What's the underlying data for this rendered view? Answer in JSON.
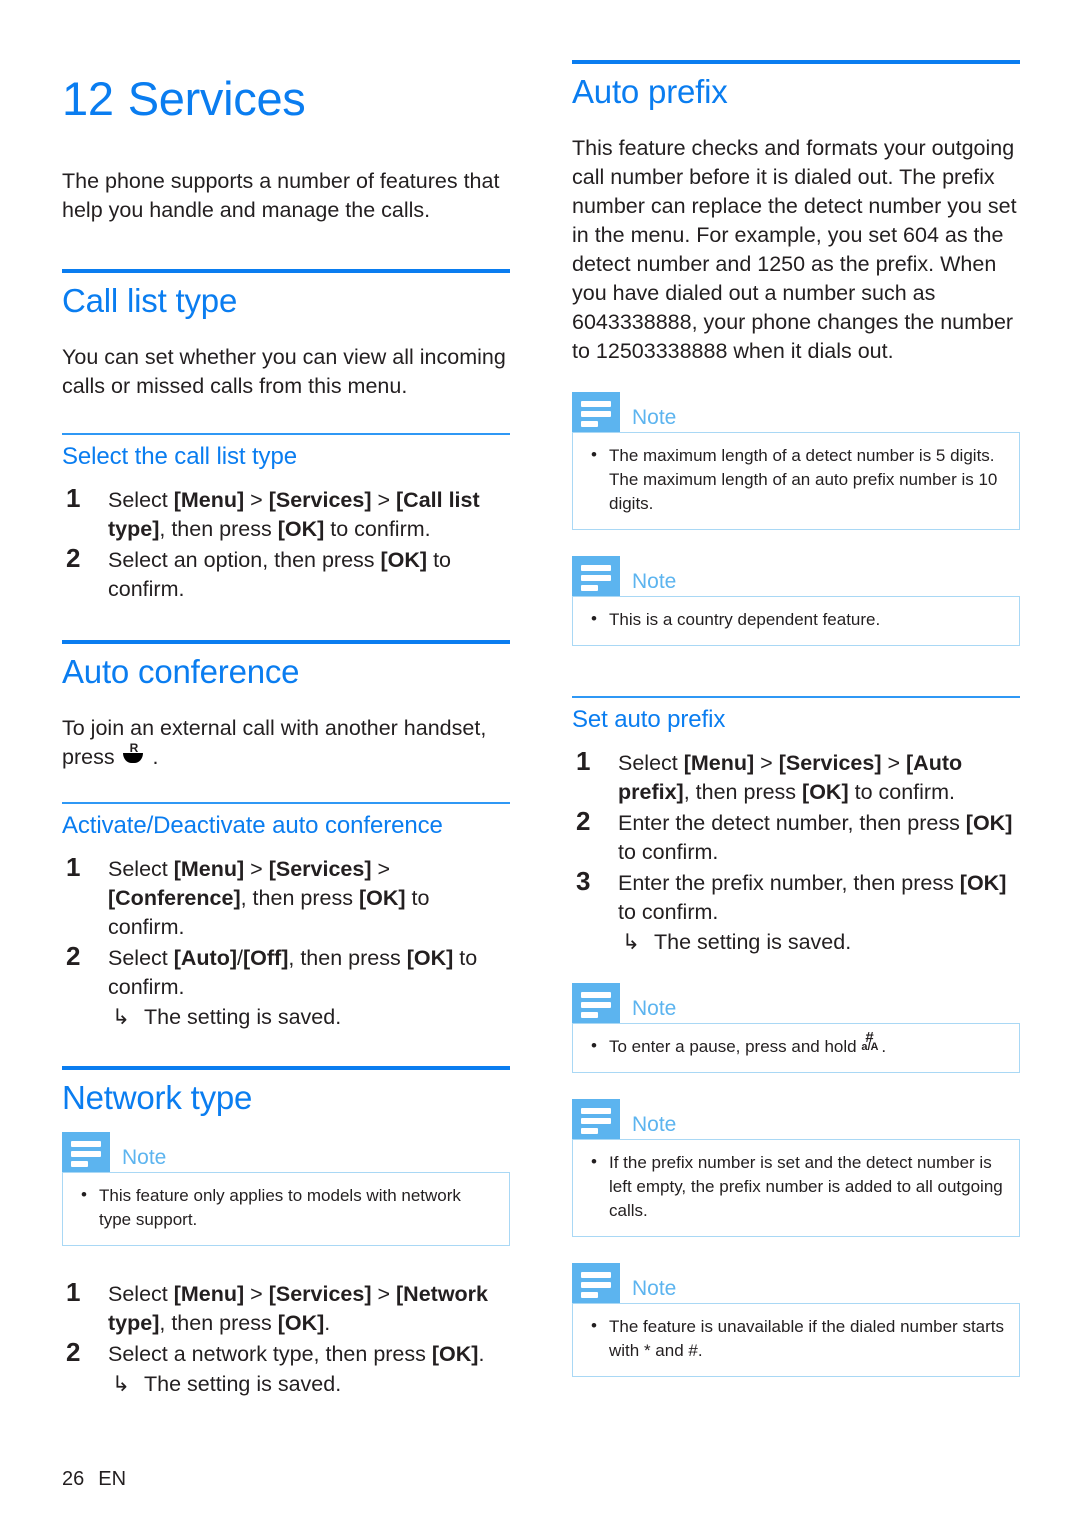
{
  "chapter": {
    "number": "12",
    "title": "Services",
    "intro": "The phone supports a number of features that help you handle and manage the calls."
  },
  "note_label": "Note",
  "bullet_glyph": "•",
  "result_arrow": "↳",
  "colors": {
    "accent_blue": "#0a7df0",
    "light_blue": "#5cb4ef",
    "note_border": "#a9d8f5",
    "body_text": "#231f20"
  },
  "sections": {
    "call_list_type": {
      "heading": "Call list type",
      "intro": "You can set whether you can view all incoming calls or missed calls from this menu.",
      "subheading": "Select the call list type",
      "steps": [
        {
          "num": "1",
          "parts": [
            {
              "t": "Select ",
              "b": false
            },
            {
              "t": "[Menu]",
              "b": true
            },
            {
              "t": " > ",
              "b": false
            },
            {
              "t": "[Services]",
              "b": true
            },
            {
              "t": " > ",
              "b": false
            },
            {
              "t": "[Call list type]",
              "b": true
            },
            {
              "t": ", then press ",
              "b": false
            },
            {
              "t": "[OK]",
              "b": true
            },
            {
              "t": " to confirm.",
              "b": false
            }
          ]
        },
        {
          "num": "2",
          "parts": [
            {
              "t": "Select an option, then press ",
              "b": false
            },
            {
              "t": "[OK]",
              "b": true
            },
            {
              "t": " to confirm.",
              "b": false
            }
          ]
        }
      ]
    },
    "auto_conference": {
      "heading": "Auto conference",
      "intro_before_key": "To join an external call with another handset, press ",
      "intro_key_icon": "recall-key-icon",
      "intro_after_key": " .",
      "subheading": "Activate/Deactivate auto conference",
      "steps": [
        {
          "num": "1",
          "parts": [
            {
              "t": "Select ",
              "b": false
            },
            {
              "t": "[Menu]",
              "b": true
            },
            {
              "t": " > ",
              "b": false
            },
            {
              "t": "[Services]",
              "b": true
            },
            {
              "t": " > ",
              "b": false
            },
            {
              "t": "[Conference]",
              "b": true
            },
            {
              "t": ", then press ",
              "b": false
            },
            {
              "t": "[OK]",
              "b": true
            },
            {
              "t": " to confirm.",
              "b": false
            }
          ]
        },
        {
          "num": "2",
          "parts": [
            {
              "t": "Select ",
              "b": false
            },
            {
              "t": "[Auto]",
              "b": true
            },
            {
              "t": "/",
              "b": false
            },
            {
              "t": "[Off]",
              "b": true
            },
            {
              "t": ", then press ",
              "b": false
            },
            {
              "t": "[OK]",
              "b": true
            },
            {
              "t": " to confirm.",
              "b": false
            }
          ],
          "result": "The setting is saved."
        }
      ]
    },
    "network_type": {
      "heading": "Network type",
      "note": "This feature only applies to models with network type support.",
      "steps": [
        {
          "num": "1",
          "parts": [
            {
              "t": "Select ",
              "b": false
            },
            {
              "t": "[Menu]",
              "b": true
            },
            {
              "t": " > ",
              "b": false
            },
            {
              "t": "[Services]",
              "b": true
            },
            {
              "t": " > ",
              "b": false
            },
            {
              "t": "[Network type]",
              "b": true
            },
            {
              "t": ", then press ",
              "b": false
            },
            {
              "t": "[OK]",
              "b": true
            },
            {
              "t": ".",
              "b": false
            }
          ]
        },
        {
          "num": "2",
          "parts": [
            {
              "t": "Select a network type, then press ",
              "b": false
            },
            {
              "t": "[OK]",
              "b": true
            },
            {
              "t": ".",
              "b": false
            }
          ],
          "result": "The setting is saved."
        }
      ]
    },
    "auto_prefix": {
      "heading": "Auto prefix",
      "intro": "This feature checks and formats your outgoing call number before it is dialed out. The prefix number can replace the detect number you set in the menu. For example, you set 604 as the detect number and 1250 as the prefix. When you have dialed out a number such as 6043338888, your phone changes the number to 12503338888 when it dials out.",
      "note_1": "The maximum length of a detect number is 5 digits. The maximum length of an auto prefix number is 10 digits.",
      "note_2": "This is a country dependent feature.",
      "subheading": "Set auto prefix",
      "steps": [
        {
          "num": "1",
          "parts": [
            {
              "t": "Select ",
              "b": false
            },
            {
              "t": "[Menu]",
              "b": true
            },
            {
              "t": " > ",
              "b": false
            },
            {
              "t": "[Services]",
              "b": true
            },
            {
              "t": " > ",
              "b": false
            },
            {
              "t": "[Auto prefix]",
              "b": true
            },
            {
              "t": ", then press ",
              "b": false
            },
            {
              "t": "[OK]",
              "b": true
            },
            {
              "t": " to confirm.",
              "b": false
            }
          ]
        },
        {
          "num": "2",
          "parts": [
            {
              "t": "Enter the detect number, then press ",
              "b": false
            },
            {
              "t": "[OK]",
              "b": true
            },
            {
              "t": " to confirm.",
              "b": false
            }
          ]
        },
        {
          "num": "3",
          "parts": [
            {
              "t": "Enter the prefix number, then press ",
              "b": false
            },
            {
              "t": "[OK]",
              "b": true
            },
            {
              "t": " to confirm.",
              "b": false
            }
          ],
          "result": "The setting is saved."
        }
      ],
      "note_3_before_key": "To enter a pause, press and hold ",
      "note_3_key_icon": "hash-aA-key-icon",
      "note_3_after_key": ".",
      "note_4": "If the prefix number is set and the detect number is left empty, the prefix number is added to all outgoing calls.",
      "note_5": "The feature is unavailable if the dialed number starts with * and #."
    }
  },
  "footer": {
    "page_number": "26",
    "language": "EN"
  }
}
